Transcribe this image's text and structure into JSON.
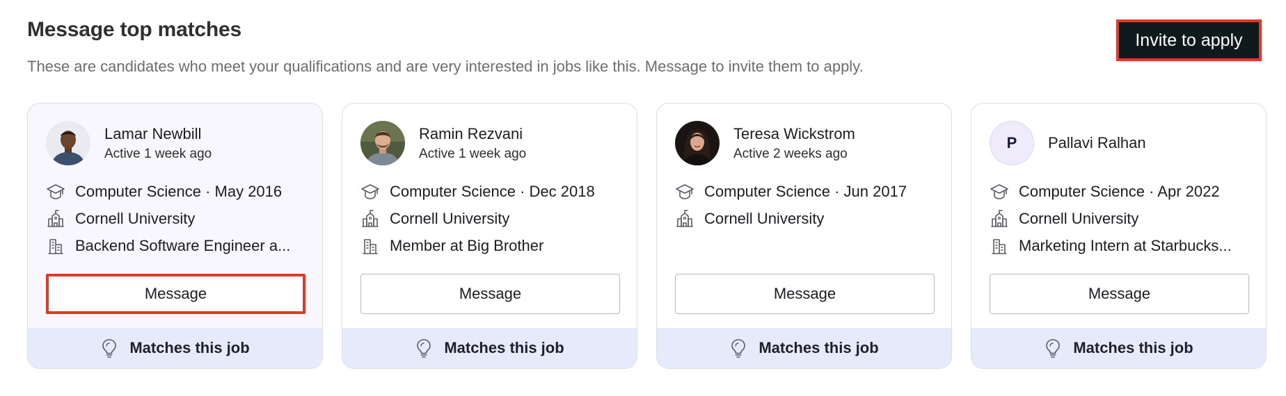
{
  "header": {
    "title": "Message top matches",
    "subtitle": "These are candidates who meet your qualifications and are very interested in jobs like this. Message to invite them to apply.",
    "invite_label": "Invite to apply"
  },
  "colors": {
    "highlight": "#e3372a",
    "invite_bg": "#0f1a1c",
    "footer_bg": "#e6ebfb",
    "card_border": "#dcdde8"
  },
  "icons": {
    "education": "graduation-cap-icon",
    "school": "university-building-icon",
    "work": "office-building-icon",
    "match": "lightbulb-icon"
  },
  "candidates": [
    {
      "name": "Lamar Newbill",
      "active": "Active 1 week ago",
      "education": "Computer Science · May 2016",
      "school": "Cornell University",
      "work": "Backend Software Engineer a...",
      "message_label": "Message",
      "match_label": "Matches this job"
    },
    {
      "name": "Ramin Rezvani",
      "active": "Active 1 week ago",
      "education": "Computer Science · Dec 2018",
      "school": "Cornell University",
      "work": "Member at Big Brother",
      "message_label": "Message",
      "match_label": "Matches this job"
    },
    {
      "name": "Teresa Wickstrom",
      "active": "Active 2 weeks ago",
      "education": "Computer Science · Jun 2017",
      "school": "Cornell University",
      "message_label": "Message",
      "match_label": "Matches this job"
    },
    {
      "name": "Pallavi Ralhan",
      "initial": "P",
      "education": "Computer Science · Apr 2022",
      "school": "Cornell University",
      "work": "Marketing Intern at Starbucks...",
      "message_label": "Message",
      "match_label": "Matches this job"
    }
  ]
}
